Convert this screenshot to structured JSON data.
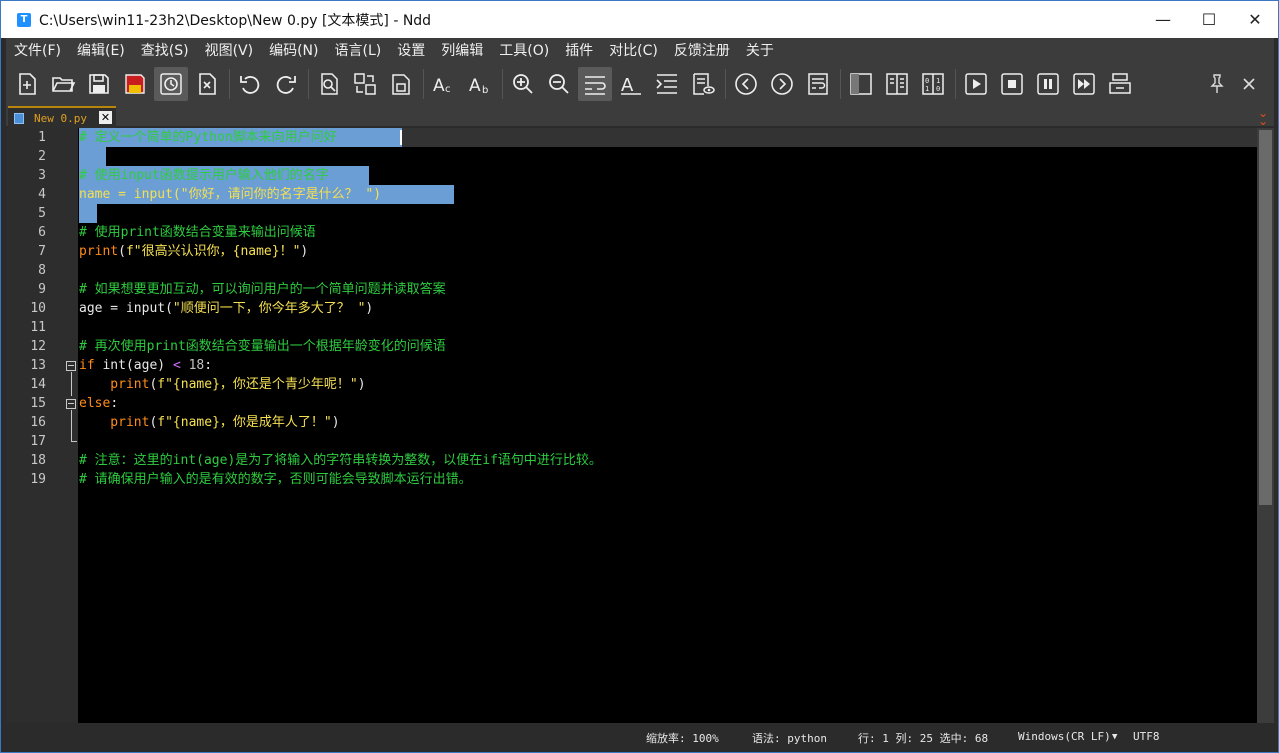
{
  "window": {
    "title": "C:\\Users\\win11-23h2\\Desktop\\New 0.py [文本模式] - Ndd",
    "app_icon_glyph": "T",
    "controls": {
      "minimize": "—",
      "maximize": "☐",
      "close": "✕"
    }
  },
  "menu": [
    "文件(F)",
    "编辑(E)",
    "查找(S)",
    "视图(V)",
    "编码(N)",
    "语言(L)",
    "设置",
    "列编辑",
    "工具(O)",
    "插件",
    "对比(C)",
    "反馈注册",
    "关于"
  ],
  "tab": {
    "label": "New 0.py",
    "close": "✕"
  },
  "editor": {
    "line_numbers": [
      "1",
      "2",
      "3",
      "4",
      "5",
      "6",
      "7",
      "8",
      "9",
      "10",
      "11",
      "12",
      "13",
      "14",
      "15",
      "16",
      "17",
      "18",
      "19"
    ],
    "lines": {
      "l1": "# 定义一个简单的Python脚本来向用户问好",
      "l3": "# 使用input函数提示用户输入他们的名字",
      "l4a": "name = input(",
      "l4b": "\"你好，请问你的名字是什么？ \"",
      "l4c": ")",
      "l6": "# 使用print函数结合变量来输出问候语",
      "l7a": "print",
      "l7b": "(",
      "l7c": "f\"很高兴认识你，{name}！\"",
      "l7d": ")",
      "l9": "# 如果想要更加互动，可以询问用户的一个简单问题并读取答案",
      "l10a": "age = input(",
      "l10b": "\"顺便问一下，你今年多大了？ \"",
      "l10c": ")",
      "l12": "# 再次使用print函数结合变量输出一个根据年龄变化的问候语",
      "l13a": "if",
      "l13b": " int(age) ",
      "l13c": "<",
      "l13d": " 18",
      "l13e": ":",
      "l14a": "    print",
      "l14b": "(",
      "l14c": "f\"{name}，你还是个青少年呢！\"",
      "l14d": ")",
      "l15a": "else",
      "l15b": ":",
      "l16a": "    print",
      "l16b": "(",
      "l16c": "f\"{name}，你是成年人了！\"",
      "l16d": ")",
      "l18": "# 注意：这里的int(age)是为了将输入的字符串转换为整数，以便在if语句中进行比较。",
      "l19": "# 请确保用户输入的是有效的数字，否则可能会导致脚本运行出错。"
    }
  },
  "status": {
    "zoom": "缩放率: 100%",
    "syntax": "语法: python",
    "position": "行: 1 列: 25 选中: 68",
    "eol": "Windows(CR LF)",
    "eol_dropdown": "▼",
    "encoding": "UTF8"
  },
  "colors": {
    "comment": "#2ecc40",
    "keyword": "#ff8c1a",
    "string": "#f5e050",
    "selection": "#6a9ed4",
    "background": "#000000"
  }
}
